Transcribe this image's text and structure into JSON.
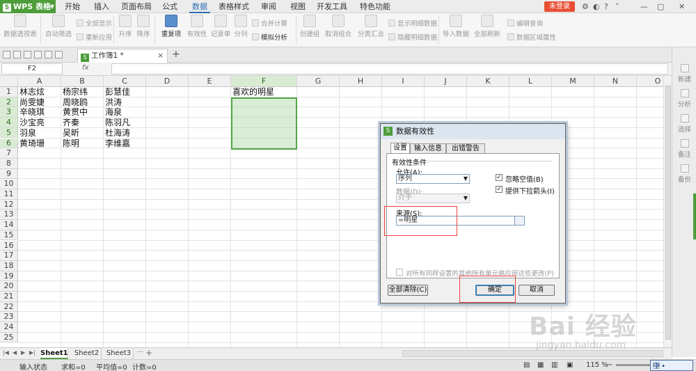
{
  "app": {
    "name": "WPS 表格",
    "logo_letter": "S",
    "login_label": "未登录"
  },
  "menu": {
    "items": [
      "开始",
      "插入",
      "页面布局",
      "公式",
      "数据",
      "表格样式",
      "审阅",
      "视图",
      "开发工具",
      "特色功能"
    ],
    "active": "数据"
  },
  "ribbon": {
    "pivot": "数据透视表",
    "autofilter": "自动筛选",
    "show_all": "全部显示",
    "reapply": "重新应用",
    "sort_asc": "升序",
    "sort_desc": "降序",
    "duplicates": "重复项",
    "validity": "有效性",
    "record_list": "记录单",
    "split_col": "分列",
    "what_if": "模拟分析",
    "consolidate": "合并计算",
    "create_group": "创建组",
    "ungroup": "取消组合",
    "subtotal": "分类汇总",
    "show_detail": "显示明细数据",
    "hide_detail": "隐藏明细数据",
    "import_data": "导入数据",
    "refresh_all": "全部刷新",
    "edit_query": "编辑查询",
    "range_props": "数据区域属性"
  },
  "quickbar": {
    "doc_tab": "工作簿1 *",
    "close_glyph": "×",
    "new_tab_glyph": "+"
  },
  "formula_bar": {
    "cell_ref": "F2",
    "fx": "fx",
    "value": ""
  },
  "grid": {
    "columns": [
      "A",
      "B",
      "C",
      "D",
      "E",
      "F",
      "G",
      "H",
      "I",
      "J",
      "K",
      "L",
      "M",
      "N",
      "O"
    ],
    "rows": [
      "1",
      "2",
      "3",
      "4",
      "5",
      "6",
      "7",
      "8",
      "9",
      "10",
      "11",
      "12",
      "13",
      "14",
      "15",
      "16",
      "17",
      "18",
      "19",
      "20",
      "21",
      "22",
      "23",
      "24",
      "25"
    ],
    "cells": {
      "A1": "林志炫",
      "B1": "杨宗纬",
      "C1": "彭慧佳",
      "F1": "喜欢的明星",
      "A2": "尚雯婕",
      "B2": "周晓鸥",
      "C2": "洪涛",
      "A3": "辛晓琪",
      "B3": "黄贯中",
      "C3": "海泉",
      "A4": "沙宝亮",
      "B4": "齐秦",
      "C4": "陈羽凡",
      "A5": "羽泉",
      "B5": "吴昕",
      "C5": "杜海涛",
      "A6": "黄琦珊",
      "B6": "陈明",
      "C6": "李维嘉"
    }
  },
  "sheets": {
    "tabs": [
      "Sheet1",
      "Sheet2",
      "Sheet3"
    ],
    "active": "Sheet1",
    "more_glyph": "···",
    "add_glyph": "+"
  },
  "sidebar": {
    "items": [
      "新建",
      "分析",
      "选择",
      "备注",
      "备份"
    ]
  },
  "statusbar": {
    "mode": "输入状态",
    "sum": "求和=0",
    "avg": "平均值=0",
    "count": "计数=0",
    "zoom": "115 %",
    "ime": "中"
  },
  "dialog": {
    "title": "数据有效性",
    "tabs": [
      "设置",
      "输入信息",
      "出错警告"
    ],
    "active_tab": "设置",
    "section": "有效性条件",
    "allow_label": "允许(A):",
    "allow_value": "序列",
    "data_label": "数据(D):",
    "data_value": "介于",
    "ignore_blank": "忽略空值(B)",
    "dropdown_arrow": "提供下拉箭头(I)",
    "source_label": "来源(S):",
    "source_value": "=明星",
    "apply_all": "对所有同样设置的其他所有单元格应用这些更改(P)",
    "clear_all": "全部清除(C)",
    "ok": "确定",
    "cancel": "取消"
  },
  "watermark": {
    "brand": "Bai 经验",
    "url": "jingyan.baidu.com"
  },
  "colors": {
    "accent_green": "#4d9d3a",
    "login_red": "#e94e33",
    "highlight_red": "#e8423a",
    "menu_blue": "#2b6db5"
  }
}
